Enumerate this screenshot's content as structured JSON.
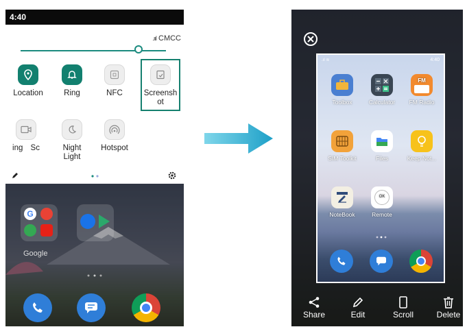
{
  "left": {
    "time": "4:40",
    "carrier": "CMCC",
    "tiles_row1": [
      {
        "label": "Location",
        "icon": "location-icon",
        "active": true
      },
      {
        "label": "Ring",
        "icon": "bell-icon",
        "active": true
      },
      {
        "label": "NFC",
        "icon": "nfc-icon",
        "active": false
      },
      {
        "label": "Screensh ot",
        "icon": "screenshot-icon",
        "active": false
      }
    ],
    "tiles_row2": [
      {
        "label": "ing Sc",
        "icon": "screen-record-icon",
        "active": false
      },
      {
        "label": "Night Light",
        "icon": "moon-icon",
        "active": false
      },
      {
        "label": "Hotspot",
        "icon": "hotspot-icon",
        "active": false
      }
    ],
    "home_label": "Google"
  },
  "right": {
    "preview_status_time": "4:40",
    "apps": [
      "Toolbox",
      "Calculator",
      "FM Radio",
      "SIM Toolkit",
      "Files",
      "Keep Not...",
      "NoteBook",
      "Remote"
    ],
    "fm_badge": "FM",
    "remote_badge": "OK",
    "actions": [
      "Share",
      "Edit",
      "Scroll",
      "Delete"
    ]
  }
}
